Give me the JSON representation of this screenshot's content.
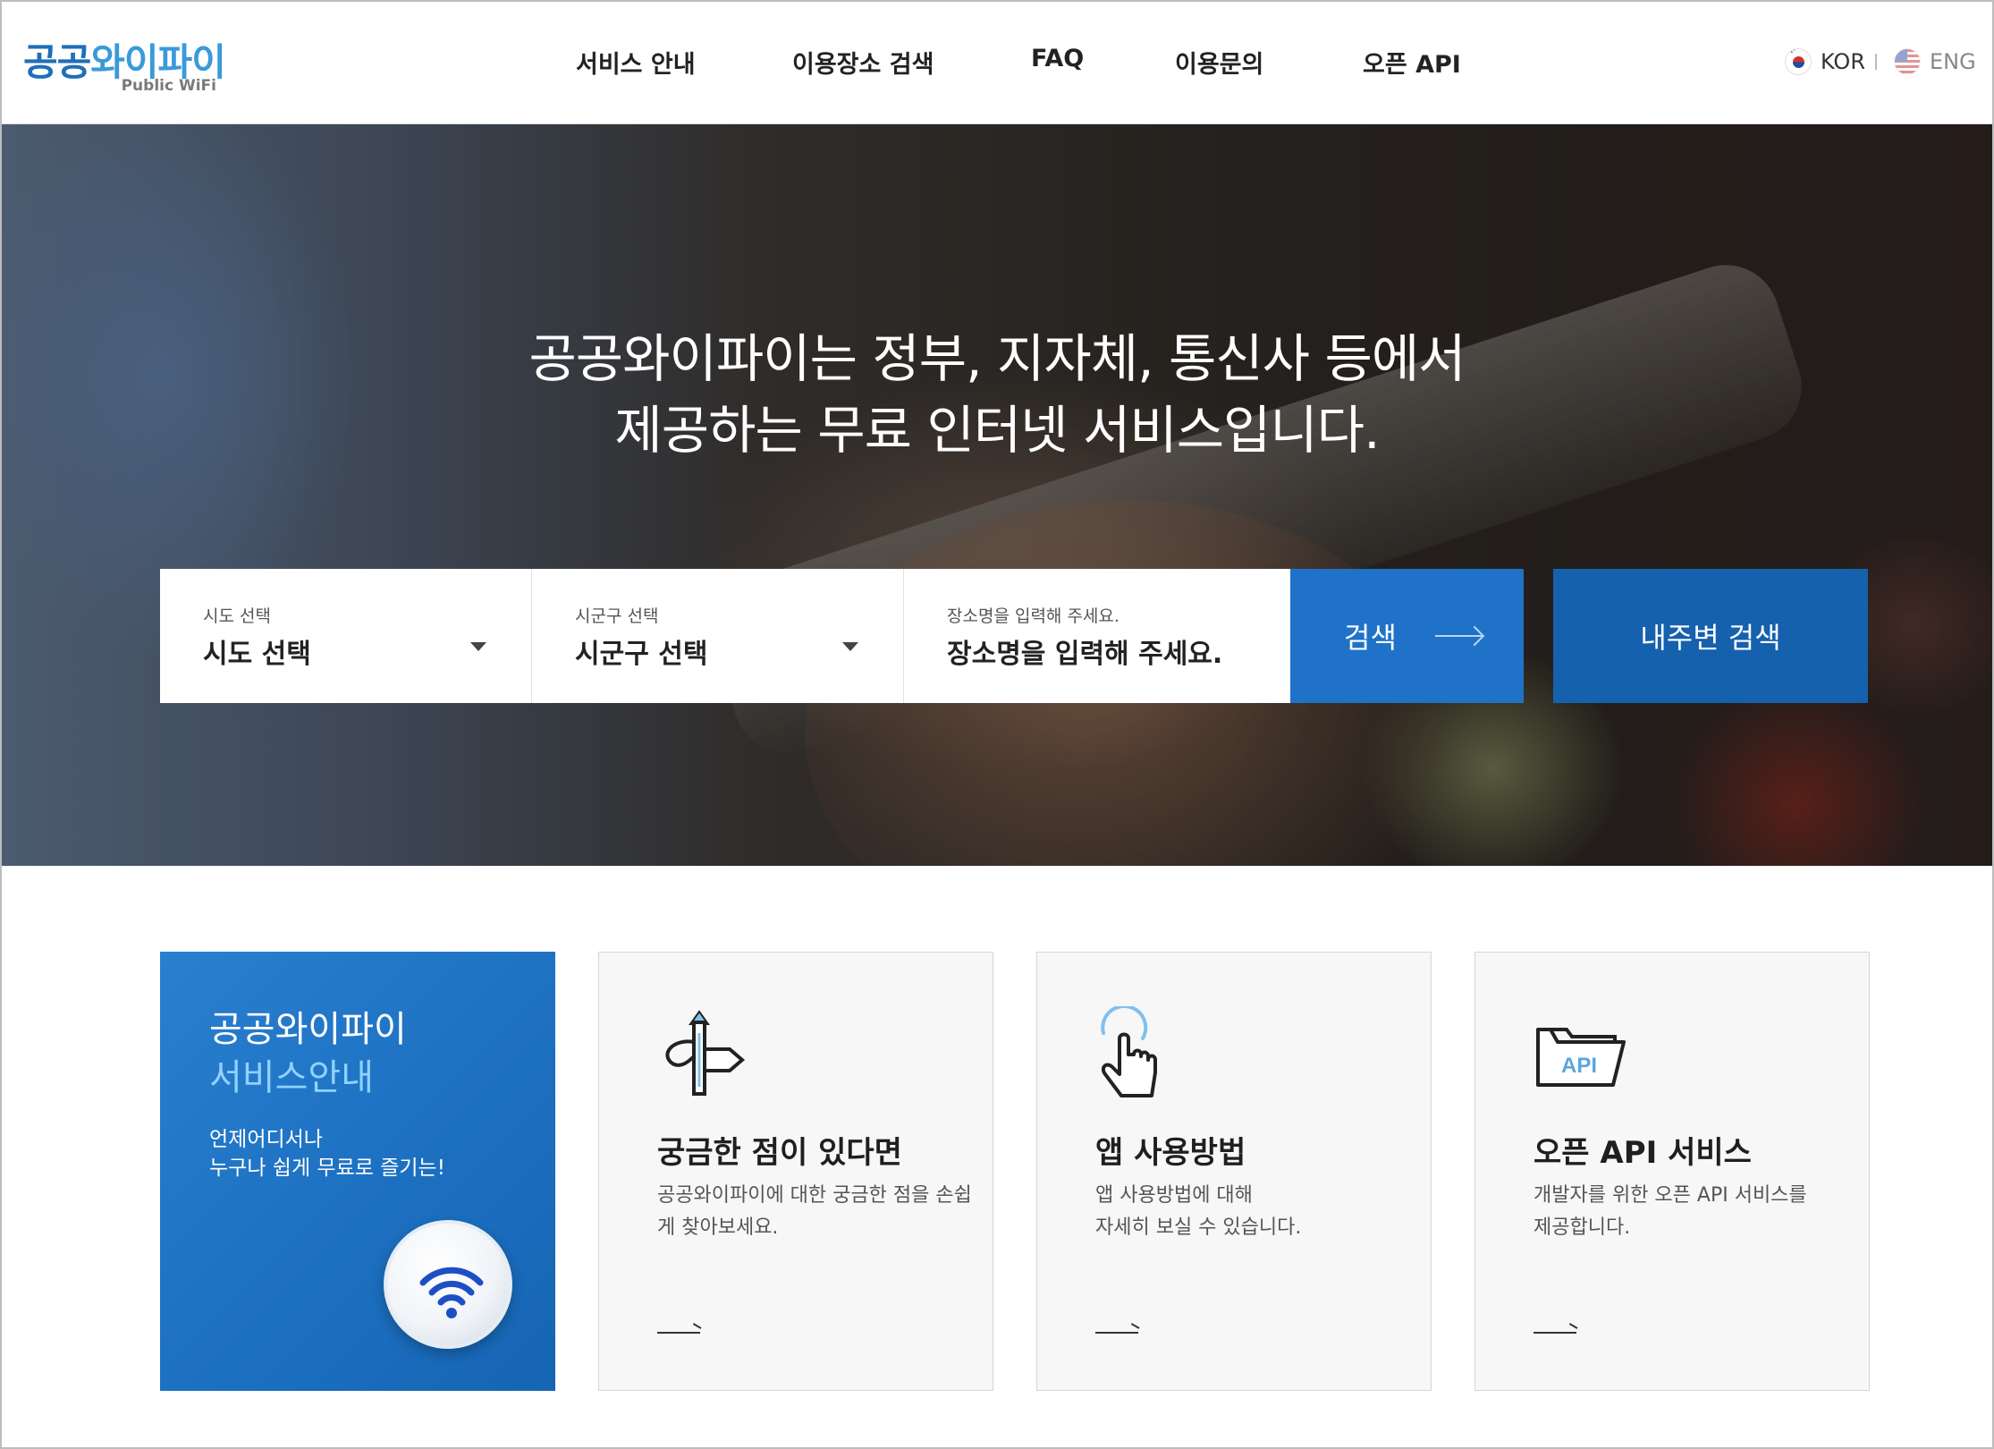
{
  "header": {
    "logo_kr_1": "공공",
    "logo_kr_2": "와이파이",
    "logo_en": "Public WiFi",
    "nav": [
      "서비스 안내",
      "이용장소 검색",
      "FAQ",
      "이용문의",
      "오픈 API"
    ],
    "lang": {
      "kor": "KOR",
      "eng": "ENG"
    }
  },
  "hero": {
    "line1": "공공와이파이는 정부, 지자체, 통신사 등에서",
    "line2": "제공하는 무료 인터넷 서비스입니다."
  },
  "search": {
    "sido": {
      "label": "시도 선택",
      "value": "시도 선택"
    },
    "sigungu": {
      "label": "시군구 선택",
      "value": "시군구 선택"
    },
    "place": {
      "label": "장소명을 입력해 주세요.",
      "value": "장소명을 입력해 주세요."
    },
    "search_button": "검색",
    "nearby_button": "내주변 검색"
  },
  "cards": {
    "service": {
      "title_1": "공공와이파이",
      "title_2": "서비스안내",
      "desc_1": "언제어디서나",
      "desc_2": "누구나 쉽게 무료로 즐기는!"
    },
    "faq": {
      "title": "궁금한 점이 있다면",
      "body": "공공와이파이에 대한 궁금한 점을 손쉽게 찾아보세요.",
      "icon": "direction-sign-icon"
    },
    "app": {
      "title": "앱 사용방법",
      "body_1": "앱 사용방법에 대해",
      "body_2": "자세히 보실 수 있습니다.",
      "icon": "tap-hand-icon"
    },
    "api": {
      "title": "오픈 API 서비스",
      "body_1": "개발자를 위한 오픈 API 서비스를",
      "body_2": "제공합니다.",
      "icon_text": "API",
      "icon": "folder-api-icon"
    }
  },
  "colors": {
    "primary": "#1f72c8",
    "primary_dark": "#1661ad",
    "accent_light": "#8fd2ff",
    "logo_blue": "#1f6fb8"
  }
}
